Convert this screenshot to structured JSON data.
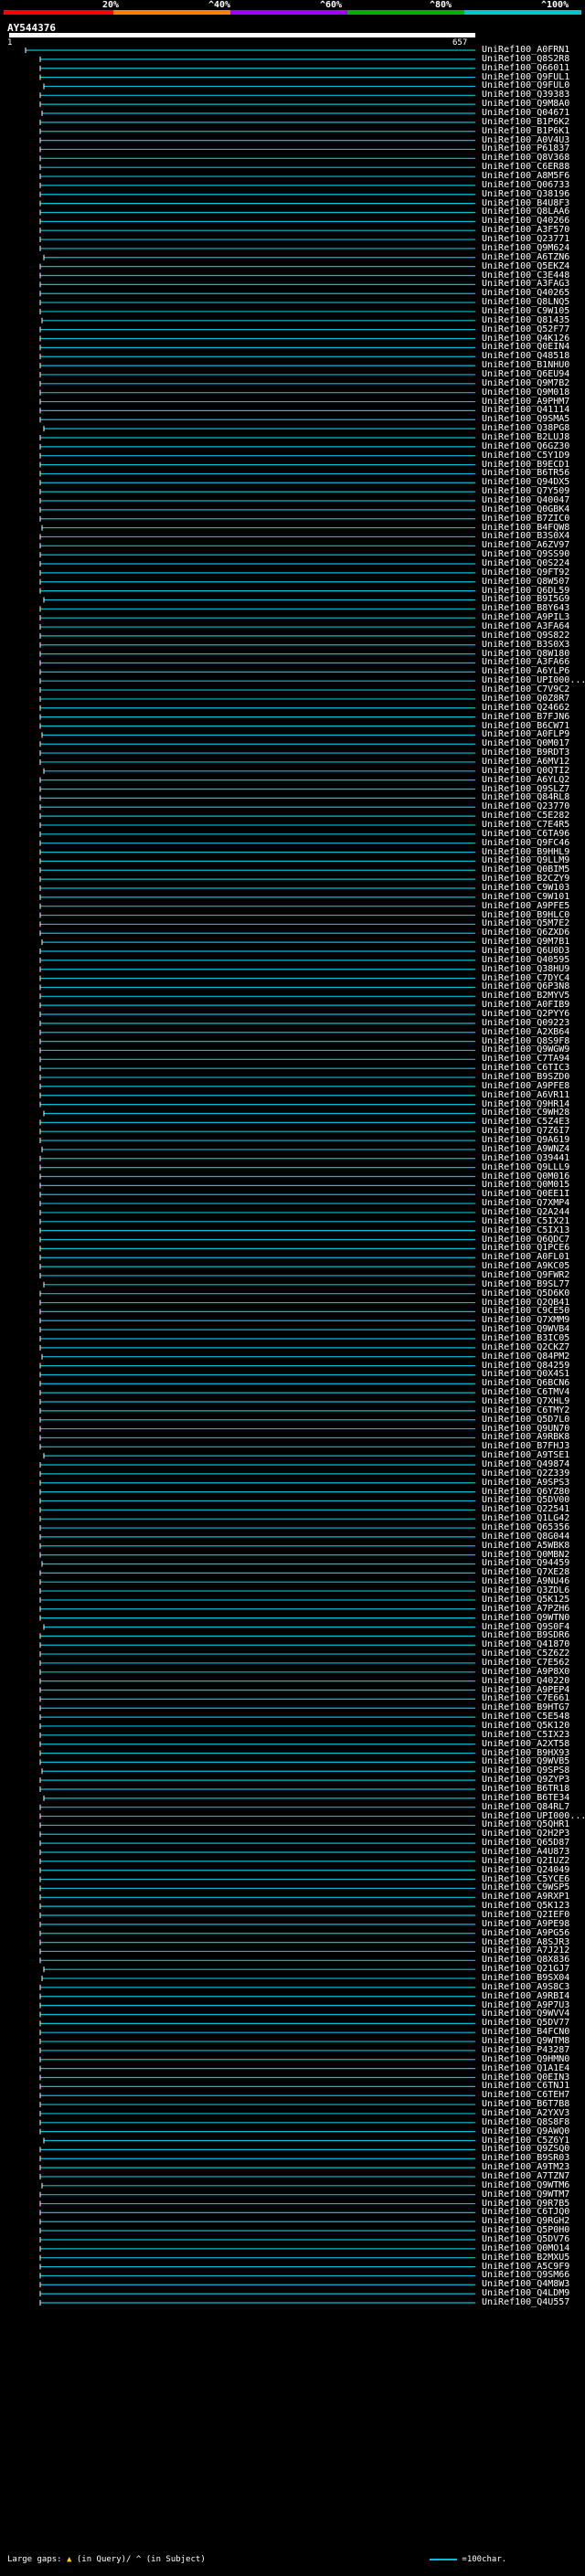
{
  "header": {
    "ticks": [
      "20%",
      "^40%",
      "^60%",
      "^80%",
      "^100%"
    ],
    "bar_colors": [
      "#ff0000",
      "#ff8000",
      "#a000ff",
      "#00b000",
      "#00c8c8"
    ]
  },
  "query": {
    "name": "AY544376",
    "start": "1",
    "end": "657"
  },
  "colors": {
    "hit": "#00bfd8",
    "gap": "#ffffff"
  },
  "hits": [
    "UniRef100_A0FRN1",
    "UniRef100_Q8S2R8",
    "UniRef100_Q66011",
    "UniRef100_Q9FUL1",
    "UniRef100_Q9FUL0",
    "UniRef100_Q39383",
    "UniRef100_Q9M8A0",
    "UniRef100_Q04671",
    "UniRef100_B1P6K2",
    "UniRef100_B1P6K1",
    "UniRef100_A0V4U3",
    "UniRef100_P61837",
    "UniRef100_Q8V368",
    "UniRef100_C6ER88",
    "UniRef100_A8M5F6",
    "UniRef100_Q06733",
    "UniRef100_Q38196",
    "UniRef100_B4U8F3",
    "UniRef100_Q8LAA6",
    "UniRef100_Q40266",
    "UniRef100_A3F570",
    "UniRef100_Q23771",
    "UniRef100_Q9M624",
    "UniRef100_A6TZN6",
    "UniRef100_Q5EKZ4",
    "UniRef100_C3E448",
    "UniRef100_A3FAG3",
    "UniRef100_Q40265",
    "UniRef100_Q8LNQ5",
    "UniRef100_C9W105",
    "UniRef100_Q81435",
    "UniRef100_Q52F77",
    "UniRef100_Q4K126",
    "UniRef100_Q0EIN4",
    "UniRef100_Q48518",
    "UniRef100_B1NHU0",
    "UniRef100_Q6EU94",
    "UniRef100_Q9M7B2",
    "UniRef100_Q9M018",
    "UniRef100_A9PHM7",
    "UniRef100_Q41114",
    "UniRef100_Q9SMA5",
    "UniRef100_Q38PG8",
    "UniRef100_B2LUJ8",
    "UniRef100_Q6GZ30",
    "UniRef100_C5Y1D9",
    "UniRef100_B9ECD1",
    "UniRef100_B6TR56",
    "UniRef100_Q94DX5",
    "UniRef100_Q7Y509",
    "UniRef100_Q40047",
    "UniRef100_Q0GBK4",
    "UniRef100_B7ZIC0",
    "UniRef100_B4FQW8",
    "UniRef100_B3S0X4",
    "UniRef100_A6ZV97",
    "UniRef100_Q9SS90",
    "UniRef100_Q0S224",
    "UniRef100_Q9FT92",
    "UniRef100_Q8W507",
    "UniRef100_Q6DL59",
    "UniRef100_B9I5G9",
    "UniRef100_B8Y643",
    "UniRef100_A9PIL3",
    "UniRef100_A3FA64",
    "UniRef100_Q9S822",
    "UniRef100_B3S0X3",
    "UniRef100_Q8W180",
    "UniRef100_A3FA66",
    "UniRef100_A6YLP6",
    "UniRef100_UPI000...",
    "UniRef100_C7V9C2",
    "UniRef100_Q0Z8R7",
    "UniRef100_Q24662",
    "UniRef100_B7FJN6",
    "UniRef100_B6CW71",
    "UniRef100_A0FLP9",
    "UniRef100_Q0M017",
    "UniRef100_B9RDT3",
    "UniRef100_A6MV12",
    "UniRef100_Q0QTI2",
    "UniRef100_A6YLQ2",
    "UniRef100_Q9SLZ7",
    "UniRef100_Q84RL8",
    "UniRef100_Q23770",
    "UniRef100_C5E282",
    "UniRef100_C7E4R5",
    "UniRef100_C6TA96",
    "UniRef100_Q9FC46",
    "UniRef100_B9HHL9",
    "UniRef100_Q9LLM9",
    "UniRef100_Q0BIM5",
    "UniRef100_B2CZY9",
    "UniRef100_C9W103",
    "UniRef100_C9W101",
    "UniRef100_A9PFE5",
    "UniRef100_B9HLC0",
    "UniRef100_Q5M7E2",
    "UniRef100_Q6ZXD6",
    "UniRef100_Q9M7B1",
    "UniRef100_Q6U0D3",
    "UniRef100_Q40595",
    "UniRef100_Q38HU9",
    "UniRef100_C7DYC4",
    "UniRef100_Q6P3N8",
    "UniRef100_B2MYV5",
    "UniRef100_A0FIB9",
    "UniRef100_Q2PYY6",
    "UniRef100_Q09223",
    "UniRef100_A2XB64",
    "UniRef100_Q8S9F8",
    "UniRef100_Q9WGW9",
    "UniRef100_C7TA94",
    "UniRef100_C6TIC3",
    "UniRef100_B9SZD0",
    "UniRef100_A9PFE8",
    "UniRef100_A6VR11",
    "UniRef100_Q9HR14",
    "UniRef100_C9WH28",
    "UniRef100_C5Z4E3",
    "UniRef100_Q7Z6I7",
    "UniRef100_Q9A619",
    "UniRef100_A9WNZ4",
    "UniRef100_Q39441",
    "UniRef100_Q9LLL9",
    "UniRef100_Q0M016",
    "UniRef100_Q0M015",
    "UniRef100_Q0EE1I",
    "UniRef100_Q7XMP4",
    "UniRef100_Q2A244",
    "UniRef100_C5IX21",
    "UniRef100_C5IX13",
    "UniRef100_Q6QDC7",
    "UniRef100_Q1PCE6",
    "UniRef100_A0FL01",
    "UniRef100_A9KC05",
    "UniRef100_Q9FWR2",
    "UniRef100_B9SL77",
    "UniRef100_Q5D6K0",
    "UniRef100_Q2QB41",
    "UniRef100_C9CE50",
    "UniRef100_Q7XMM9",
    "UniRef100_Q9WVB4",
    "UniRef100_B3IC05",
    "UniRef100_Q2CKZ7",
    "UniRef100_Q84PM2",
    "UniRef100_Q84259",
    "UniRef100_Q0X4S1",
    "UniRef100_Q6BCN6",
    "UniRef100_C6TMV4",
    "UniRef100_Q7XHL9",
    "UniRef100_C6TMY2",
    "UniRef100_Q5D7L0",
    "UniRef100_Q9UN70",
    "UniRef100_A9RBK8",
    "UniRef100_B7FHJ3",
    "UniRef100_A9TSE1",
    "UniRef100_Q49874",
    "UniRef100_Q2Z339",
    "UniRef100_A9SPS3",
    "UniRef100_Q6YZ80",
    "UniRef100_Q5DV00",
    "UniRef100_Q22541",
    "UniRef100_Q1LG42",
    "UniRef100_Q65356",
    "UniRef100_Q8G044",
    "UniRef100_A5WBK8",
    "UniRef100_Q0MBN2",
    "UniRef100_Q94459",
    "UniRef100_Q7XE28",
    "UniRef100_A9NU46",
    "UniRef100_Q3ZDL6",
    "UniRef100_Q5K125",
    "UniRef100_A7PZH6",
    "UniRef100_Q9WTN0",
    "UniRef100_Q9S0F4",
    "UniRef100_B9SDR6",
    "UniRef100_Q41870",
    "UniRef100_C5Z6Z2",
    "UniRef100_C7E562",
    "UniRef100_A9P8X0",
    "UniRef100_Q40220",
    "UniRef100_A9PEP4",
    "UniRef100_C7E661",
    "UniRef100_B9HTG7",
    "UniRef100_C5E548",
    "UniRef100_Q5K120",
    "UniRef100_C5IX23",
    "UniRef100_A2XT58",
    "UniRef100_B9HX93",
    "UniRef100_Q9WVB5",
    "UniRef100_Q9SPS8",
    "UniRef100_Q9ZYP3",
    "UniRef100_B6TR18",
    "UniRef100_B6TE34",
    "UniRef100_Q84RL7",
    "UniRef100_UPI000...",
    "UniRef100_Q5QHR1",
    "UniRef100_Q2H2P3",
    "UniRef100_Q65D87",
    "UniRef100_A4U873",
    "UniRef100_Q2IUZ2",
    "UniRef100_Q24049",
    "UniRef100_C5YCE6",
    "UniRef100_C9WSP5",
    "UniRef100_A9RXP1",
    "UniRef100_Q5K123",
    "UniRef100_Q2IEF0",
    "UniRef100_A9PE98",
    "UniRef100_A9PG56",
    "UniRef100_A8SJR3",
    "UniRef100_A7J212",
    "UniRef100_Q8X836",
    "UniRef100_Q21GJ7",
    "UniRef100_B9SX04",
    "UniRef100_A9S8C3",
    "UniRef100_A9RBI4",
    "UniRef100_A9P7U3",
    "UniRef100_Q9WVV4",
    "UniRef100_Q5DV77",
    "UniRef100_B4FCN0",
    "UniRef100_Q9WTM8",
    "UniRef100_P43287",
    "UniRef100_Q9HMN0",
    "UniRef100_Q1A1E4",
    "UniRef100_Q0EIN3",
    "UniRef100_C6TNJ1",
    "UniRef100_C6TEH7",
    "UniRef100_B6T7B8",
    "UniRef100_A2YXV3",
    "UniRef100_Q8S8F8",
    "UniRef100_Q9AWQ0",
    "UniRef100_C5Z6Y1",
    "UniRef100_Q9ZSQ0",
    "UniRef100_B9SR03",
    "UniRef100_A9TM23",
    "UniRef100_A7TZN7",
    "UniRef100_Q9WTM6",
    "UniRef100_Q9WTM7",
    "UniRef100_Q9R7B5",
    "UniRef100_C6TJQ0",
    "UniRef100_Q9RGH2",
    "UniRef100_Q5P0H0",
    "UniRef100_Q5DV76",
    "UniRef100_Q0MO14",
    "UniRef100_B2MXU5",
    "UniRef100_A5C9F9",
    "UniRef100_Q9SM66",
    "UniRef100_Q4M8W3",
    "UniRef100_Q4LDM9",
    "UniRef100_Q4U557"
  ],
  "footer": {
    "gaps_label": "Large gaps:",
    "in_query": "(in Query)/",
    "in_subject": "(in Subject)",
    "legend": "=100char."
  }
}
